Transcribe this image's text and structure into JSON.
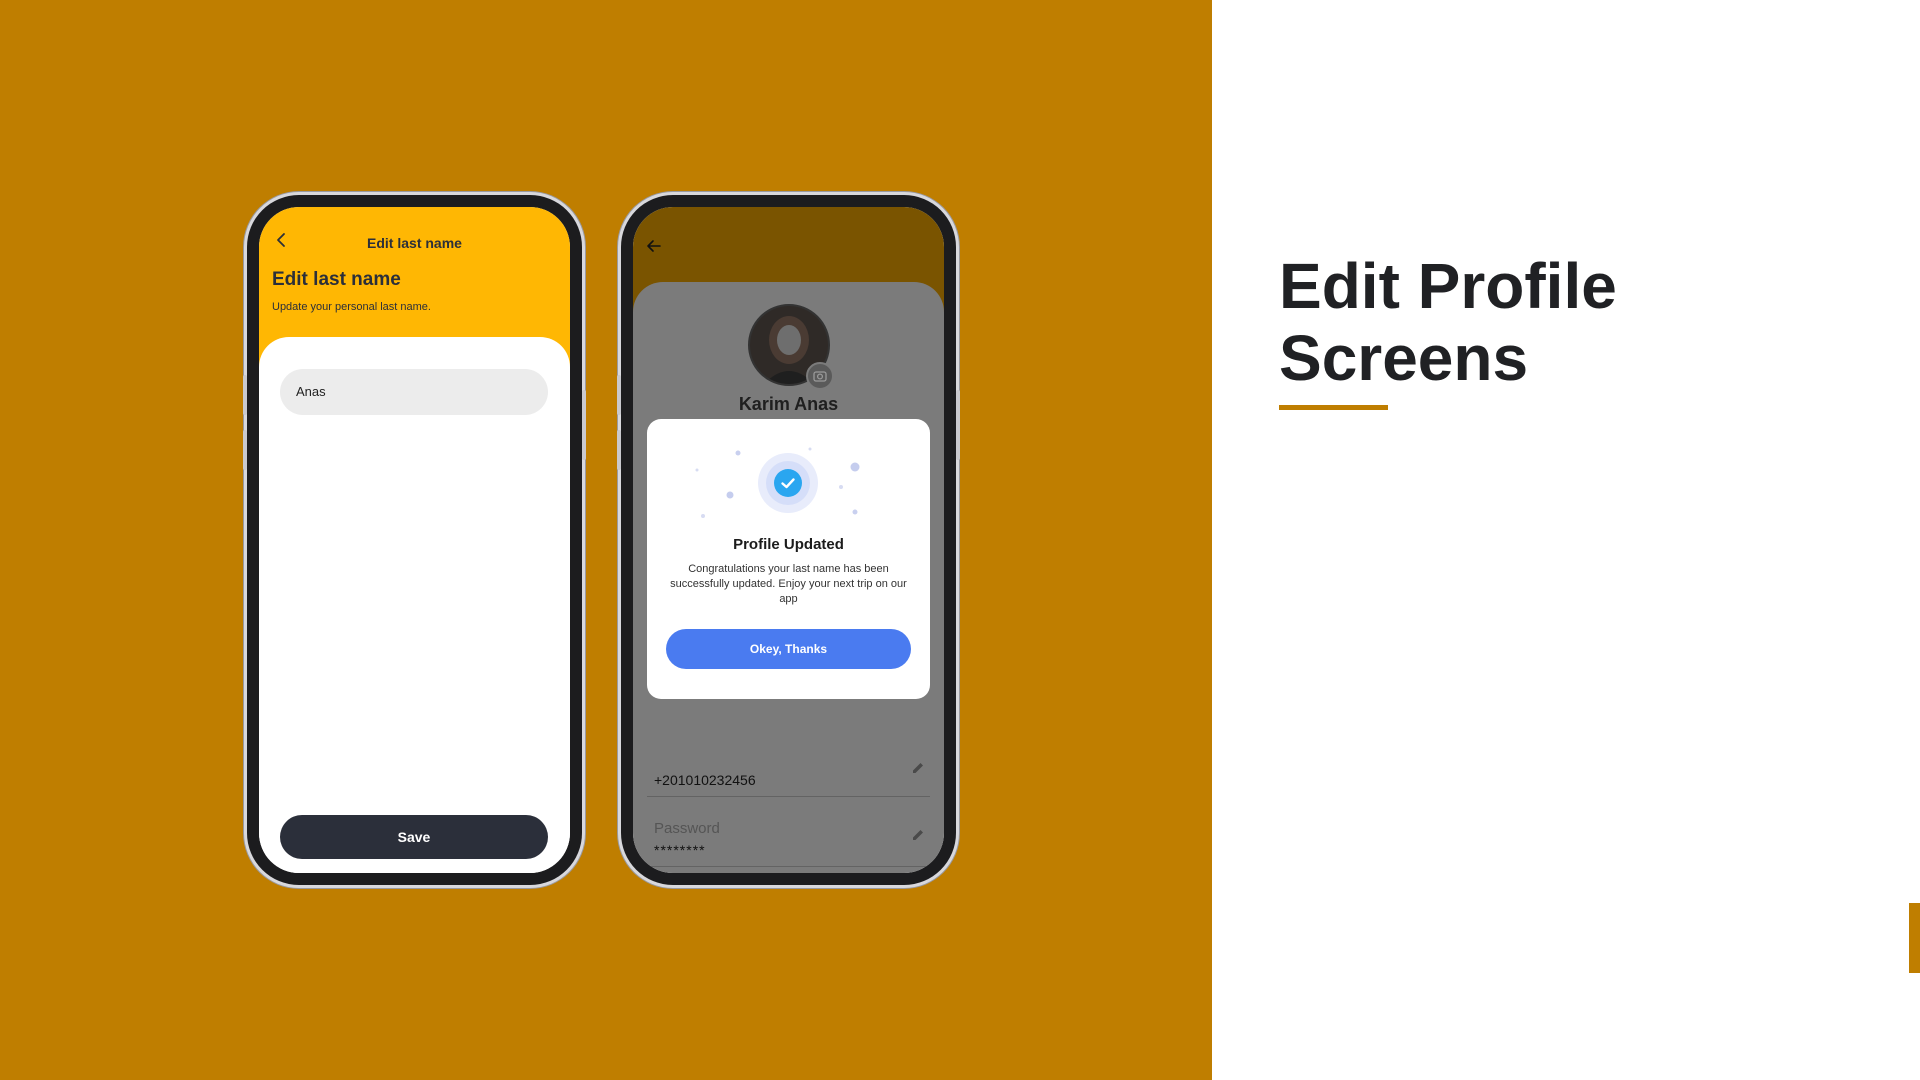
{
  "colors": {
    "background_left": "#bf7e00",
    "accent_rule": "#bf7e00",
    "phone1_header": "#ffb703",
    "save_button": "#2b2f3a",
    "modal_button": "#4a7bf0",
    "check_badge": "#2aa6f0"
  },
  "phone1": {
    "nav_title": "Edit last name",
    "page_title": "Edit last name",
    "subtitle": "Update your personal last name.",
    "input_value": "Anas",
    "save_label": "Save"
  },
  "phone2": {
    "profile_name": "Karim Anas",
    "phone_value": "+201010232456",
    "password_label": "Password",
    "password_value": "********",
    "modal": {
      "title": "Profile Updated",
      "message": "Congratulations your last name has been successfully updated. Enjoy your next trip on our app",
      "button_label": "Okey, Thanks"
    }
  },
  "side": {
    "heading_line1": "Edit Profile",
    "heading_line2": "Screens"
  }
}
